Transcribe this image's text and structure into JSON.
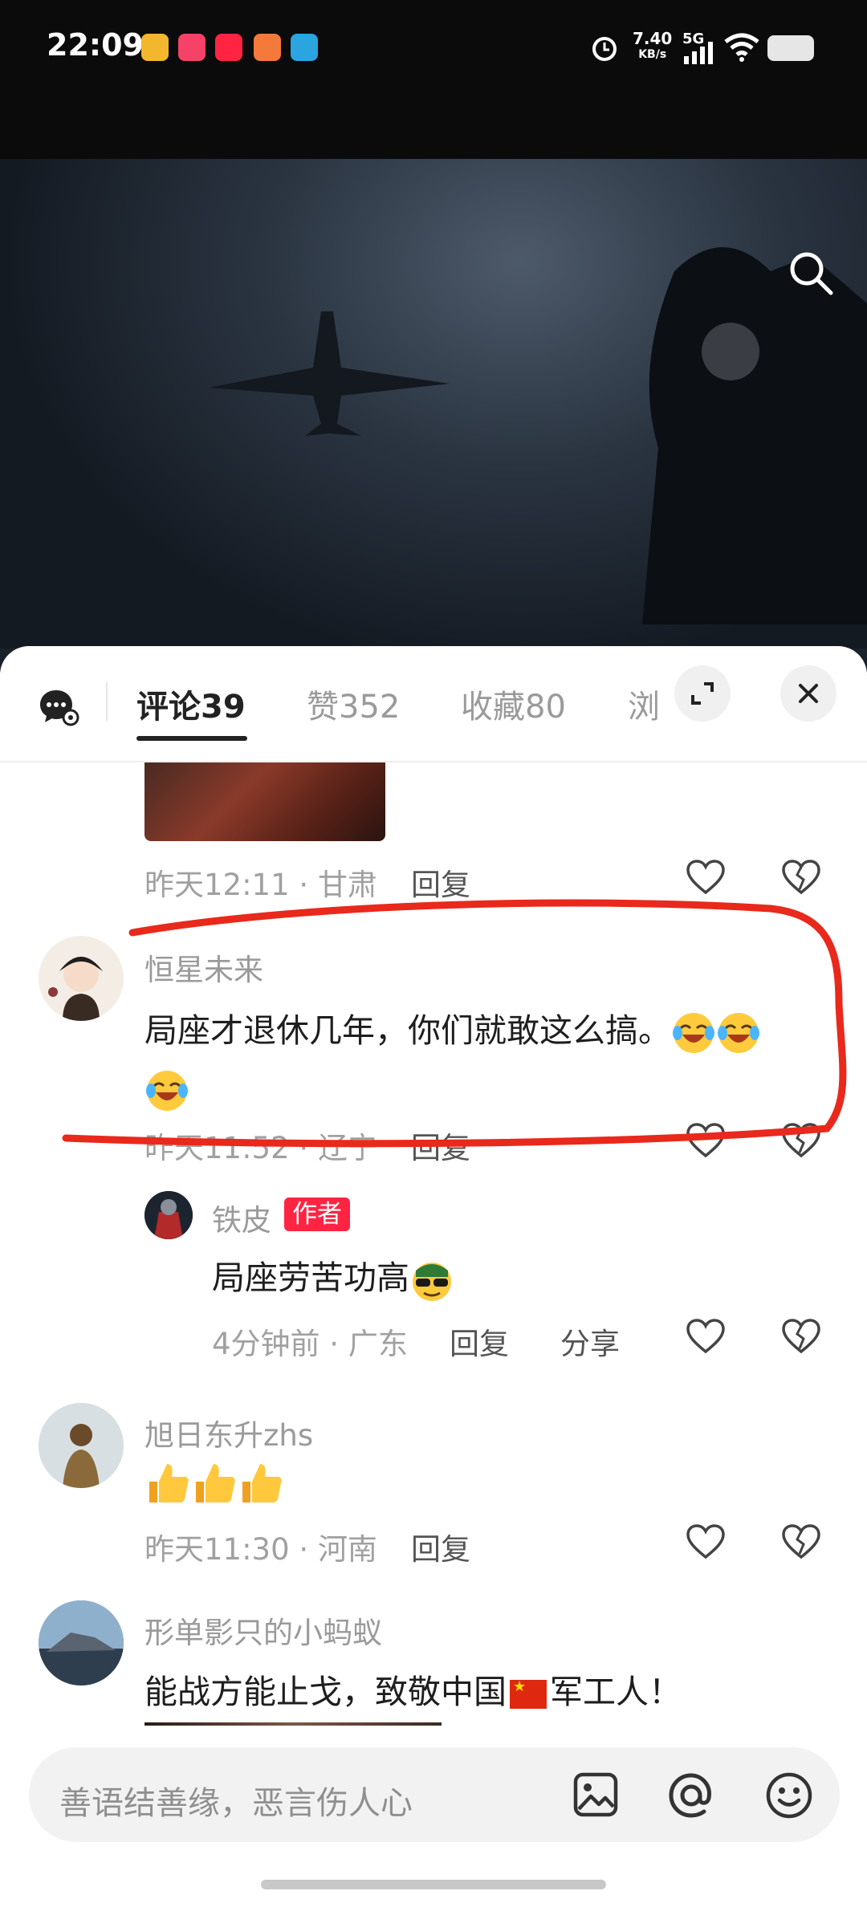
{
  "status_bar": {
    "time": "22:09",
    "net_speed_value": "7.40",
    "net_speed_unit": "KB/s",
    "network": "5G",
    "app_icons": [
      "weibo-icon",
      "taobao-icon",
      "xiaohongshu-icon",
      "bilibili-icon",
      "telegram-icon"
    ]
  },
  "video": {
    "search_icon": "search-icon"
  },
  "tabs": [
    {
      "label": "评论",
      "count": "39",
      "active": true
    },
    {
      "label": "赞",
      "count": "352",
      "active": false
    },
    {
      "label": "收藏",
      "count": "80",
      "active": false
    },
    {
      "label": "浏",
      "count": "",
      "active": false
    }
  ],
  "comments": {
    "c0": {
      "time": "昨天12:11",
      "location": "甘肃",
      "reply": "回复"
    },
    "c1": {
      "author": "恒星未来",
      "text": "局座才退休几年，你们就敢这么搞。",
      "time": "昨天11:52",
      "location": "辽宁",
      "reply": "回复"
    },
    "r1": {
      "author": "铁皮",
      "badge": "作者",
      "text": "局座劳苦功高",
      "time": "4分钟前",
      "location": "广东",
      "reply": "回复",
      "share": "分享"
    },
    "c2": {
      "author": "旭日东升zhs",
      "time": "昨天11:30",
      "location": "河南",
      "reply": "回复"
    },
    "c3": {
      "author": "形单影只的小蚂蚁",
      "text_before": "能战方能止戈，致敬中国",
      "text_after": "军工人！"
    }
  },
  "input": {
    "placeholder": "善语结善缘，恶言伤人心"
  },
  "colors": {
    "accent_red": "#ff2442",
    "annotation_red": "#e8291c"
  }
}
